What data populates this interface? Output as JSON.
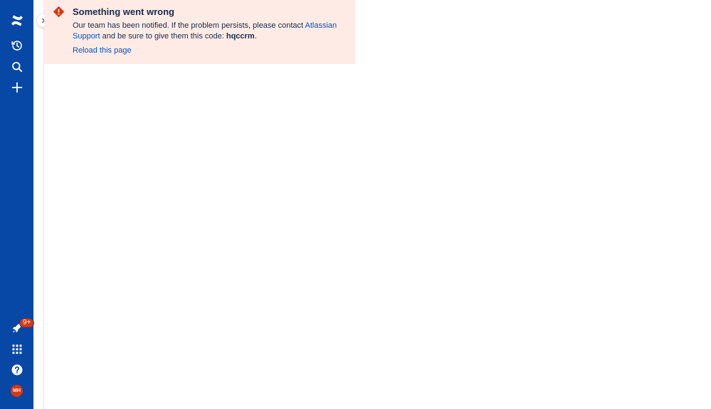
{
  "colors": {
    "nav_background": "#0747a6",
    "error_background": "#ffebe6",
    "error_icon": "#de350b",
    "link": "#0052cc",
    "badge": "#de350b"
  },
  "global_nav": {
    "items": [
      {
        "name": "confluence-logo-icon",
        "icon": "confluence-logo"
      },
      {
        "name": "recent-icon",
        "icon": "history"
      },
      {
        "name": "search-icon",
        "icon": "search"
      },
      {
        "name": "create-icon",
        "icon": "plus"
      }
    ],
    "bottom_items": [
      {
        "name": "notifications-icon",
        "icon": "rocket",
        "badge": "9+"
      },
      {
        "name": "app-switcher-icon",
        "icon": "grid"
      },
      {
        "name": "help-icon",
        "icon": "question"
      }
    ],
    "notifications_badge": "9+",
    "avatar_initials": "MH"
  },
  "error": {
    "title": "Something went wrong",
    "message_start": "Our team has been notified. If the problem persists, please contact ",
    "support_link": "Atlassian Support",
    "message_middle": " and be sure to give them this code: ",
    "code": "hqccrm",
    "message_end": ".",
    "reload_label": "Reload this page"
  }
}
